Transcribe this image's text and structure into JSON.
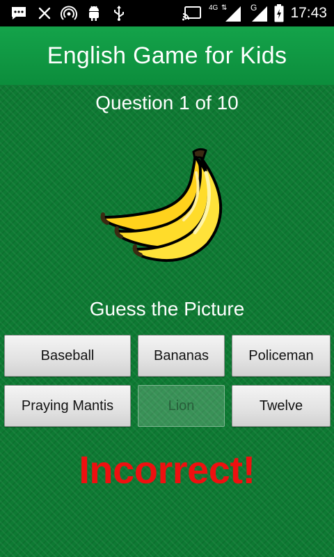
{
  "status_bar": {
    "time": "17:43",
    "network_label": "4G",
    "secondary_network_label": "G",
    "icons": [
      "message-icon",
      "close-icon",
      "hotspot-icon",
      "android-debug-icon",
      "usb-icon",
      "cast-icon",
      "signal-icon",
      "signal-icon",
      "battery-icon"
    ]
  },
  "app": {
    "title": "English Game for Kids"
  },
  "quiz": {
    "question_counter": "Question 1 of 10",
    "picture_icon": "banana-icon",
    "prompt": "Guess the Picture",
    "answers": [
      {
        "label": "Baseball",
        "enabled": true
      },
      {
        "label": "Bananas",
        "enabled": true
      },
      {
        "label": "Policeman",
        "enabled": true
      },
      {
        "label": "Praying Mantis",
        "enabled": true
      },
      {
        "label": "Lion",
        "enabled": false
      },
      {
        "label": "Twelve",
        "enabled": true
      }
    ],
    "result": "Incorrect!"
  },
  "colors": {
    "app_bar": "#10994a",
    "background": "#0e7a33",
    "result_text": "#ee1010"
  }
}
